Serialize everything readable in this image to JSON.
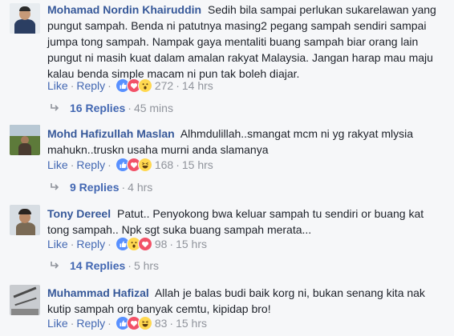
{
  "comments": [
    {
      "author": "Mohamad Nordin Khairuddin",
      "text": "Sedih bila sampai perlukan sukarelawan yang pungut sampah. Benda ni patutnya masing2 pegang sampah sendiri sampai jumpa tong sampah. Nampak gaya mentaliti buang sampah biar orang lain pungut ni masih kuat dalam amalan rakyat Malaysia. Jangan harap mau maju kalau benda simple macam ni pun tak boleh diajar.",
      "like_label": "Like",
      "reply_label": "Reply",
      "reactions": [
        "like",
        "love",
        "wow"
      ],
      "reaction_count": "272",
      "time": "14 hrs",
      "replies_label": "16 Replies",
      "replies_time": "45 mins"
    },
    {
      "author": "Mohd Hafizullah Maslan",
      "text": "Alhmdulillah..smangat mcm ni yg rakyat mlysia mahukn..truskn usaha murni anda slamanya",
      "like_label": "Like",
      "reply_label": "Reply",
      "reactions": [
        "like",
        "love",
        "haha"
      ],
      "reaction_count": "168",
      "time": "15 hrs",
      "replies_label": "9 Replies",
      "replies_time": "4 hrs"
    },
    {
      "author": "Tony Dereel",
      "text": "Patut.. Penyokong bwa keluar sampah tu sendiri or buang kat tong sampah.. Npk sgt suka buang sampah merata...",
      "like_label": "Like",
      "reply_label": "Reply",
      "reactions": [
        "like",
        "wow",
        "love"
      ],
      "reaction_count": "98",
      "time": "15 hrs",
      "replies_label": "14 Replies",
      "replies_time": "5 hrs"
    },
    {
      "author": "Muhammad Hafizal",
      "text": "Allah je balas budi baik korg ni, bukan senang kita nak kutip sampah org banyak cemtu, kipidap bro!",
      "like_label": "Like",
      "reply_label": "Reply",
      "reactions": [
        "like",
        "love",
        "haha"
      ],
      "reaction_count": "83",
      "time": "15 hrs"
    }
  ],
  "separators": {
    "dot": "·",
    "dash": "·"
  },
  "colors": {
    "link": "#365899",
    "action": "#4267b2",
    "meta": "#90949c",
    "like": "#5890ff",
    "love": "#f25268",
    "yellow": "#ffd84f"
  }
}
